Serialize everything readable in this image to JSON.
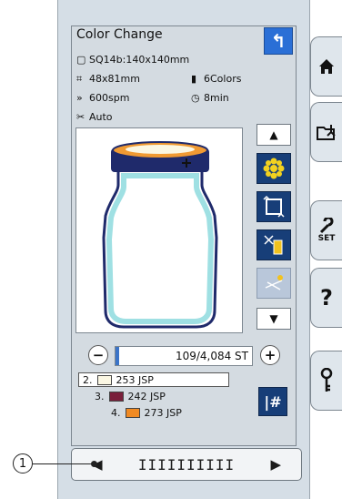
{
  "screen": {
    "title": "Color Change",
    "back_icon": "undo-arrow-icon",
    "hoop": "SQ14b:140x140mm",
    "size": "48x81mm",
    "colors": "6Colors",
    "speed": "600spm",
    "time": "8min",
    "cut_mode": "Auto"
  },
  "stitch": {
    "counter_text": "109/4,084 ST",
    "current": 109,
    "total": 4084,
    "minus": "−",
    "plus": "+"
  },
  "color_list": [
    {
      "index": "2.",
      "swatch": "#fbf7e3",
      "label": "253 JSP",
      "selected": true
    },
    {
      "index": "3.",
      "swatch": "#7a1f3b",
      "label": "242 JSP",
      "selected": false
    },
    {
      "index": "4.",
      "swatch": "#f08a23",
      "label": "273 JSP",
      "selected": false
    }
  ],
  "jump_button": "|#",
  "side_tools": [
    "scroll-up-icon",
    "color-grouping-icon",
    "trace-frame-icon",
    "thread-cut-icon",
    "jump-stitch-icon",
    "scroll-down-icon"
  ],
  "main_tabs": [
    {
      "icon": "home-icon",
      "label": ""
    },
    {
      "icon": "folder-open-icon",
      "label": ""
    },
    {
      "icon": "wrench-icon",
      "label": "SET"
    },
    {
      "icon": "help-icon",
      "label": "?"
    },
    {
      "icon": "key-icon",
      "label": ""
    }
  ],
  "callout": "1",
  "scroll_bar": {
    "left": "◀",
    "grip": "IIIIIIIIII",
    "right": "▶"
  },
  "accent_color": "#2a6fd6",
  "tool_blue": "#173e78"
}
